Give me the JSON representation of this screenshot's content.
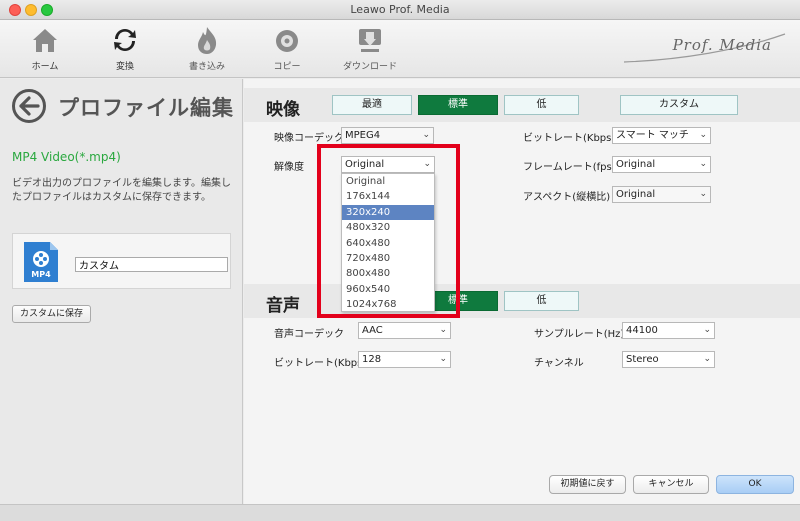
{
  "window": {
    "title": "Leawo Prof. Media"
  },
  "toolbar": {
    "items": [
      {
        "label": "ホーム"
      },
      {
        "label": "変換"
      },
      {
        "label": "書き込み"
      },
      {
        "label": "コピー"
      },
      {
        "label": "ダウンロード"
      }
    ],
    "brand": "Prof. Media"
  },
  "left": {
    "title": "プロファイル編集",
    "format_name": "MP4 Video(*.mp4)",
    "description": "ビデオ出力のプロファイルを編集します。編集したプロファイルはカスタムに保存できます。",
    "file_icon_label": "MP4",
    "profile_name": "カスタム",
    "save_button": "カスタムに保存"
  },
  "video": {
    "section_label": "映像",
    "quality": [
      "最適",
      "標準",
      "低"
    ],
    "custom": "カスタム",
    "codec_label": "映像コーデック",
    "codec_value": "MPEG4",
    "resolution_label": "解像度",
    "resolution_value": "Original",
    "bitrate_label": "ビットレート(Kbps)",
    "bitrate_value": "スマート マッチ",
    "framerate_label": "フレームレート(fps)",
    "framerate_value": "Original",
    "aspect_label": "アスペクト(縦横比)",
    "aspect_value": "Original",
    "resolution_options": [
      "Original",
      "176x144",
      "320x240",
      "480x320",
      "640x480",
      "720x480",
      "800x480",
      "960x540",
      "1024x768"
    ],
    "selected_option": "320x240"
  },
  "audio": {
    "section_label": "音声",
    "quality_standard": "標準",
    "quality_low": "低",
    "codec_label": "音声コーデック",
    "codec_value": "AAC",
    "bitrate_label": "ビットレート(Kbps)",
    "bitrate_value": "128",
    "samplerate_label": "サンプルレート(Hz)",
    "samplerate_value": "44100",
    "channel_label": "チャンネル",
    "channel_value": "Stereo"
  },
  "footer": {
    "reset": "初期値に戻す",
    "cancel": "キャンセル",
    "ok": "OK"
  },
  "colors": {
    "accent_green": "#0f7a3e",
    "highlight_red": "#e3001b",
    "selection_blue": "#5d84c2",
    "format_green": "#2aa83f"
  }
}
